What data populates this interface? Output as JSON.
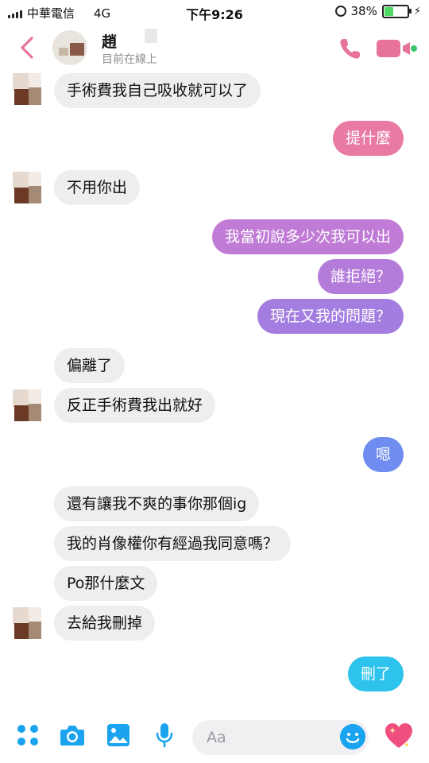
{
  "status_bar": {
    "carrier": "中華電信",
    "network": "4G",
    "time": "下午9:26",
    "battery": "38%",
    "battery_level": 0.38
  },
  "header": {
    "contact_name": "趙",
    "status": "目前在線上"
  },
  "messages": [
    {
      "side": "in",
      "text": "手術費我自己吸收就可以了"
    },
    {
      "side": "out",
      "text": "提什麼"
    },
    {
      "side": "in",
      "text": "不用你出"
    },
    {
      "side": "out",
      "text": "我當初說多少次我可以出"
    },
    {
      "side": "out",
      "text": "誰拒絕？"
    },
    {
      "side": "out",
      "text": "現在又我的問題？"
    },
    {
      "side": "in",
      "text": "偏離了"
    },
    {
      "side": "in",
      "text": "反正手術費我出就好"
    },
    {
      "side": "out",
      "text": "嗯"
    },
    {
      "side": "in",
      "text": "還有讓我不爽的事你那個ig"
    },
    {
      "side": "in",
      "text": "我的肖像權你有經過我同意嗎？"
    },
    {
      "side": "in",
      "text": "Po那什麼文"
    },
    {
      "side": "in",
      "text": "去給我刪掉"
    },
    {
      "side": "out",
      "text": "刪了"
    }
  ],
  "composer": {
    "placeholder": "Aa"
  },
  "colors": {
    "accent_pink": "#e8739a",
    "accent_blue": "#1aa3ee",
    "bubble_in": "#eeeeee",
    "bubble_pink": "#e87aa3",
    "bubble_purple": "#b67ad8",
    "bubble_lavender": "#9e7de0",
    "bubble_blue": "#6f8cf0",
    "bubble_cyan": "#2ec3ec"
  }
}
